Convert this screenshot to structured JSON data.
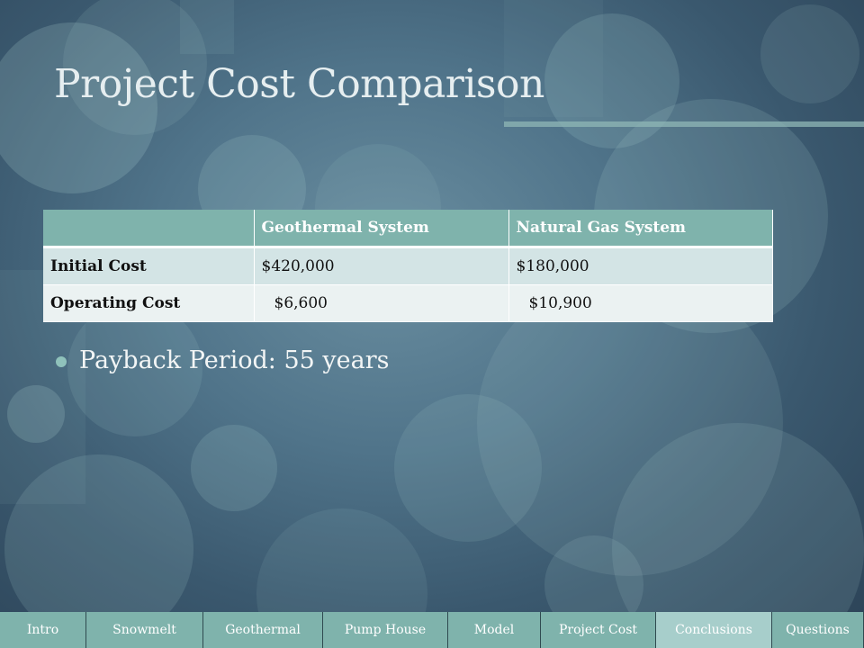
{
  "slide": {
    "title": "Project Cost Comparison"
  },
  "table": {
    "headers": [
      "",
      "Geothermal System",
      "Natural Gas System"
    ],
    "rows": [
      {
        "label": "Initial Cost",
        "geothermal": "$420,000",
        "natural_gas": "$180,000"
      },
      {
        "label": "Operating Cost",
        "geothermal": "$6,600",
        "natural_gas": "$10,900"
      }
    ]
  },
  "bullets": [
    "Payback Period: 55 years"
  ],
  "nav": [
    {
      "label": "Intro"
    },
    {
      "label": "Snowmelt"
    },
    {
      "label": "Geothermal"
    },
    {
      "label": "Pump House"
    },
    {
      "label": "Model"
    },
    {
      "label": "Project Cost"
    },
    {
      "label": "Conclusions",
      "active": true
    },
    {
      "label": "Questions"
    }
  ],
  "colors": {
    "accent": "#7fb3ac",
    "nav_active": "#a7cecb",
    "background_dark": "#2b4256",
    "background_light": "#6a8ea0"
  }
}
